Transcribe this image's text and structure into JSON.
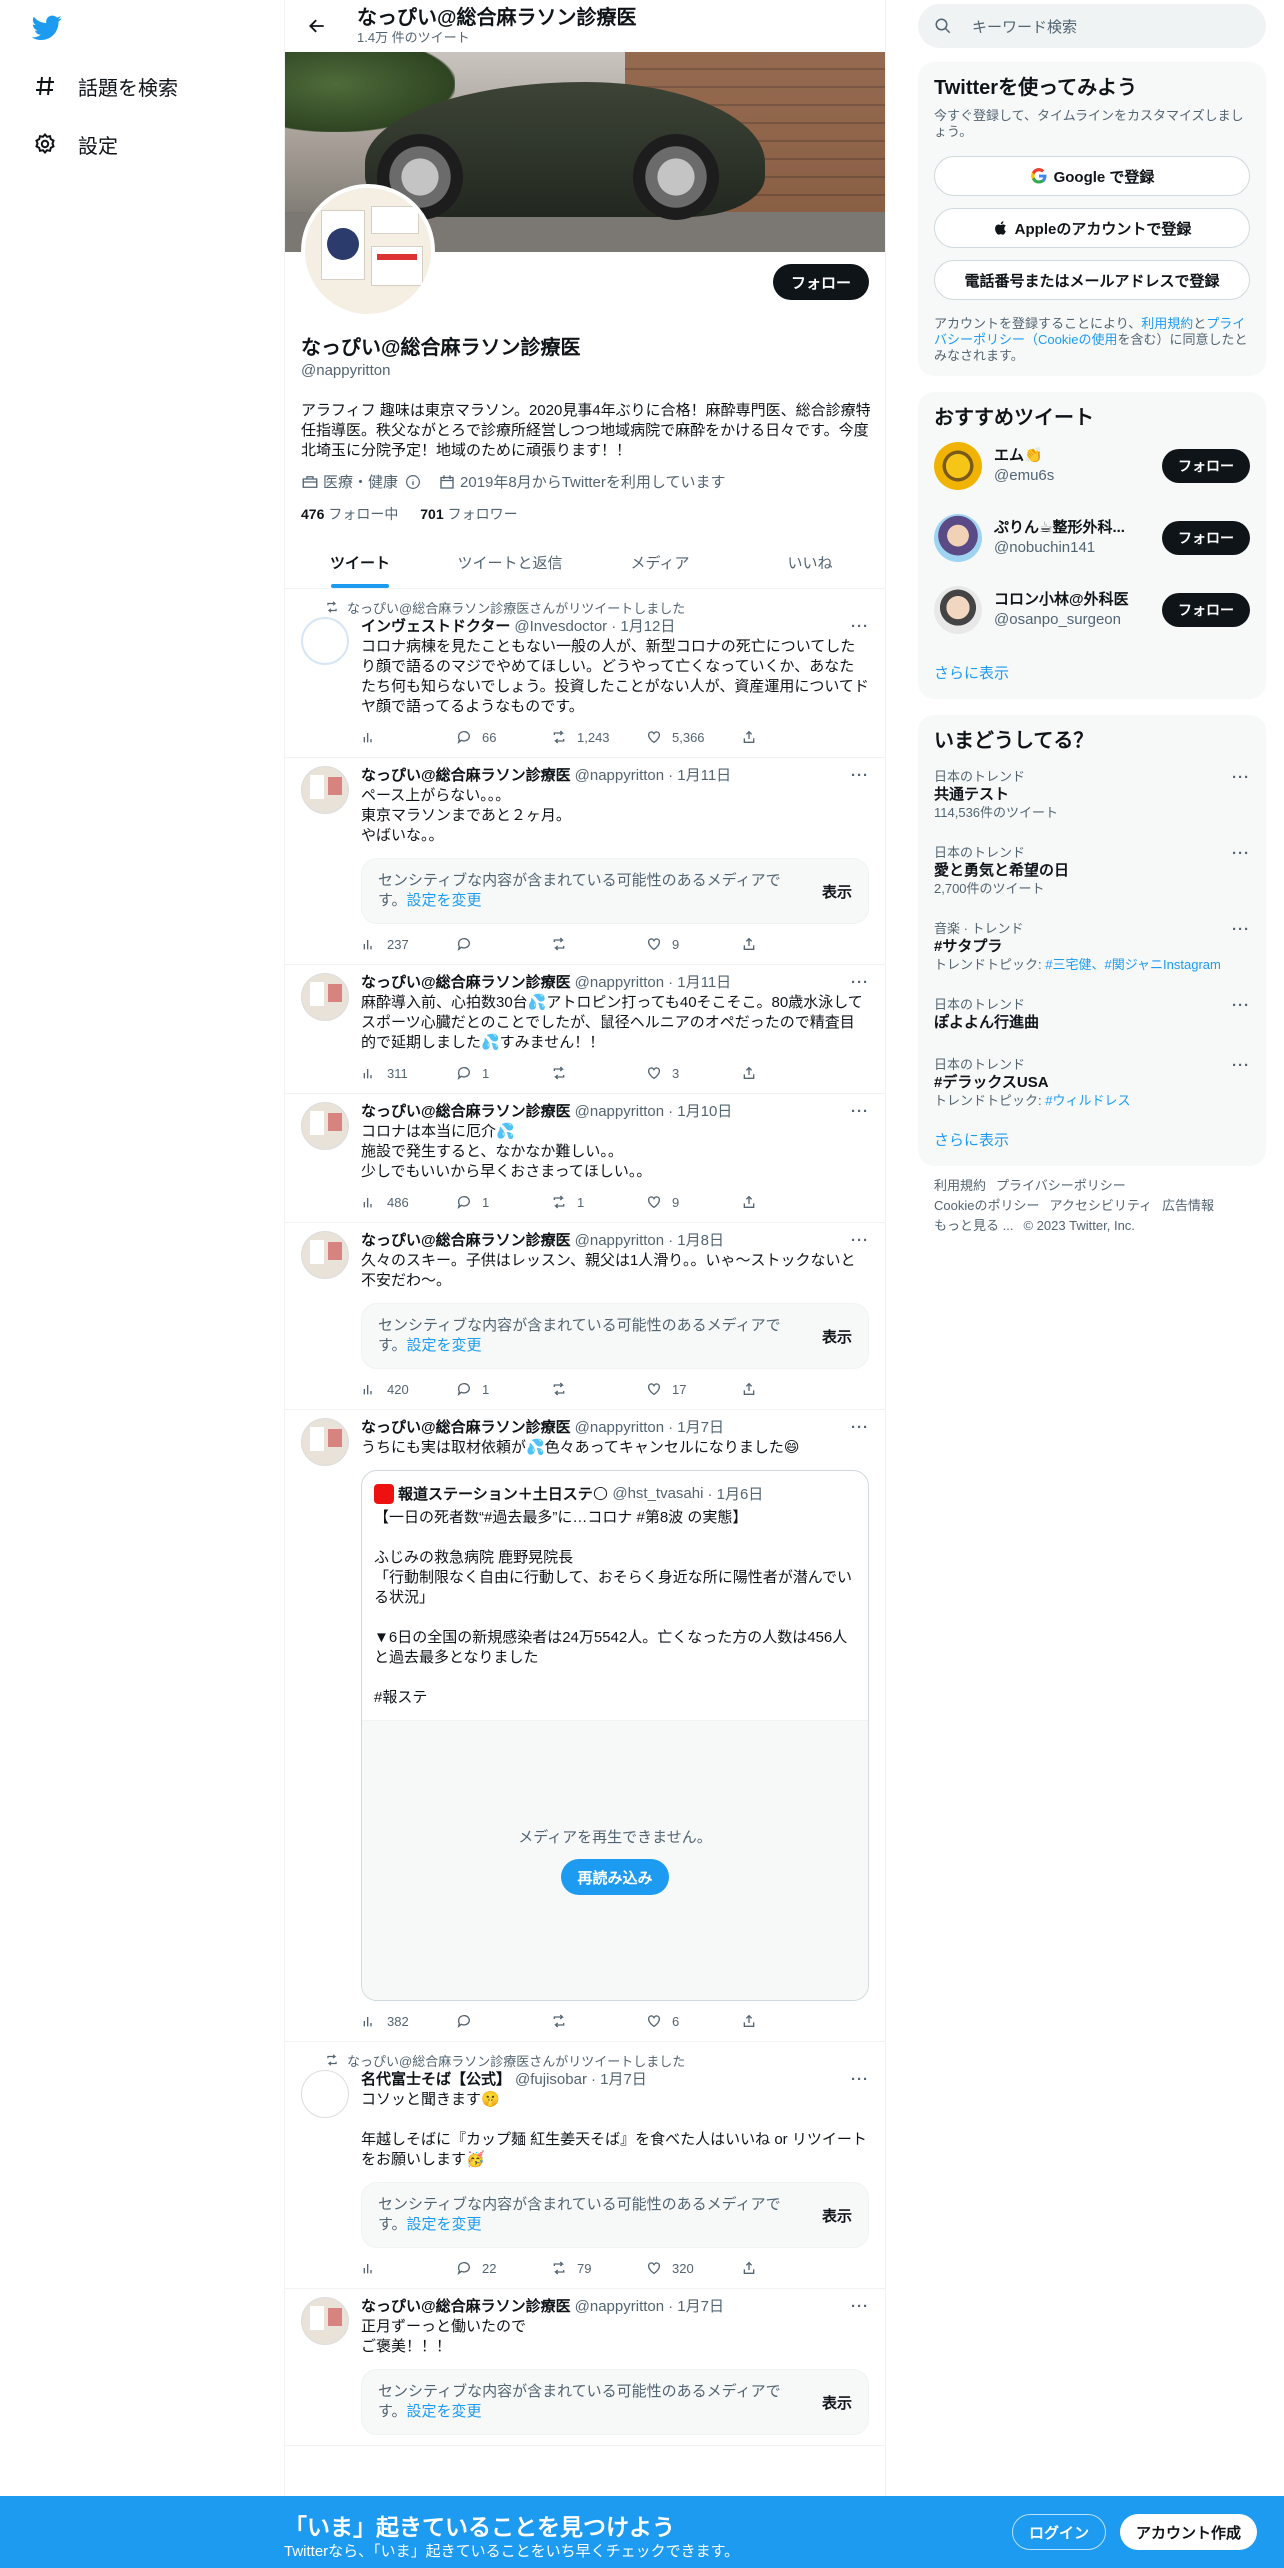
{
  "nav": {
    "explore": "話題を検索",
    "settings": "設定"
  },
  "header": {
    "title": "なっぴい@総合麻ラソン診療医",
    "tweet_count": "1.4万 件のツイート"
  },
  "profile": {
    "follow": "フォロー",
    "name": "なっぴい@総合麻ラソン診療医",
    "handle": "@nappyritton",
    "bio": "アラフィフ 趣味は東京マラソン。2020見事4年ぶりに合格！麻酔専門医、総合診療特任指導医。秩父ながとろで診療所経営しつつ地域病院で麻酔をかける日々です。今度北埼玉に分院予定！地域のために頑張ります！！",
    "category": "医療・健康",
    "joined": "2019年8月からTwitterを利用しています",
    "following_count": "476",
    "following_label": "フォロー中",
    "followers_count": "701",
    "followers_label": "フォロワー"
  },
  "tabs": [
    "ツイート",
    "ツイートと返信",
    "メディア",
    "いいね"
  ],
  "tweets": [
    {
      "retweeted_by": "なっぴい@総合麻ラソン診療医さんがリツイートしました",
      "name": "インヴェストドクター",
      "handle": "@Invesdoctor",
      "date": "· 1月12日",
      "text": "コロナ病棟を見たこともない一般の人が、新型コロナの死亡についてしたり顔で語るのマジでやめてほしい。どうやって亡くなっていくか、あなたたち何も知らないでしょう。投資したことがない人が、資産運用についてドヤ顔で語ってるようなものです。",
      "views": "",
      "replies": "66",
      "retweets": "1,243",
      "likes": "5,366"
    },
    {
      "name": "なっぴい@総合麻ラソン診療医",
      "handle": "@nappyritton",
      "date": "· 1月11日",
      "text": "ペース上がらない。。。\n東京マラソンまであと２ヶ月。\nやばいな。。",
      "sensitive": "センシティブな内容が含まれている可能性のあるメディアです。",
      "sensitive_link": "設定を変更",
      "show": "表示",
      "views": "237",
      "replies": "",
      "retweets": "",
      "likes": "9"
    },
    {
      "name": "なっぴい@総合麻ラソン診療医",
      "handle": "@nappyritton",
      "date": "· 1月11日",
      "text": "麻酔導入前、心拍数30台💦アトロピン打っても40そこそこ。80歳水泳してスポーツ心臓だとのことでしたが、鼠径ヘルニアのオペだったので精査目的で延期しました💦すみません！！",
      "views": "311",
      "replies": "1",
      "retweets": "",
      "likes": "3"
    },
    {
      "name": "なっぴい@総合麻ラソン診療医",
      "handle": "@nappyritton",
      "date": "· 1月10日",
      "text": "コロナは本当に厄介💦\n施設で発生すると、なかなか難しい。。\n少しでもいいから早くおさまってほしい。。",
      "views": "486",
      "replies": "1",
      "retweets": "1",
      "likes": "9"
    },
    {
      "name": "なっぴい@総合麻ラソン診療医",
      "handle": "@nappyritton",
      "date": "· 1月8日",
      "text": "久々のスキー。子供はレッスン、親父は1人滑り。。いゃ〜ストックないと不安だわ〜。",
      "sensitive": "センシティブな内容が含まれている可能性のあるメディアです。",
      "sensitive_link": "設定を変更",
      "show": "表示",
      "views": "420",
      "replies": "1",
      "retweets": "",
      "likes": "17"
    },
    {
      "name": "なっぴい@総合麻ラソン診療医",
      "handle": "@nappyritton",
      "date": "· 1月7日",
      "text": "うちにも実は取材依頼が💦色々あってキャンセルになりました😄",
      "quote": {
        "name": "報道ステーション＋土日ステ🌕",
        "handle": "@hst_tvasahi",
        "date": "· 1月6日",
        "text": "【一日の死者数“#過去最多”に…コロナ #第8波 の実態】\n\nふじみの救急病院 鹿野晃院長\n「行動制限なく自由に行動して、おそらく身近な所に陽性者が潜んでいる状況」\n\n▼6日の全国の新規感染者は24万5542人。亡くなった方の人数は456人と過去最多となりました\n\n#報ステ",
        "media_error": "メディアを再生できません。",
        "reload": "再読み込み"
      },
      "views": "382",
      "replies": "",
      "retweets": "",
      "likes": "6"
    },
    {
      "retweeted_by": "なっぴい@総合麻ラソン診療医さんがリツイートしました",
      "name": "名代富士そば【公式】",
      "handle": "@fujisobar",
      "date": "· 1月7日",
      "text": "コソッと聞きます🤫\n\n年越しそばに『カップ麺 紅生姜天そば』を食べた人はいいね or リツイートをお願いします🥳",
      "sensitive": "センシティブな内容が含まれている可能性のあるメディアです。",
      "sensitive_link": "設定を変更",
      "show": "表示",
      "views": "",
      "replies": "22",
      "retweets": "79",
      "likes": "320"
    },
    {
      "name": "なっぴい@総合麻ラソン診療医",
      "handle": "@nappyritton",
      "date": "· 1月7日",
      "text": "正月ずーっと働いたので\nご褒美！！！",
      "sensitive": "センシティブな内容が含まれている可能性のあるメディアです。",
      "sensitive_link": "設定を変更",
      "show": "表示"
    }
  ],
  "right": {
    "search_placeholder": "キーワード検索",
    "signup": {
      "title": "Twitterを使ってみよう",
      "subtitle": "今すぐ登録して、タイムラインをカスタマイズしましょう。",
      "google": "Google で登録",
      "apple": "Appleのアカウントで登録",
      "phone": "電話番号またはメールアドレスで登録",
      "legal_pre": "アカウントを登録することにより、",
      "legal_terms": "利用規約",
      "legal_and": "と",
      "legal_privacy": "プライバシーポリシー（Cookieの使用",
      "legal_post": "を含む）に同意したとみなされます。"
    },
    "who_to_follow": {
      "title": "おすすめツイート",
      "users": [
        {
          "name": "エム👏",
          "handle": "@emu6s",
          "button": "フォロー"
        },
        {
          "name": "ぷりん☕整形外科...",
          "handle": "@nobuchin141",
          "button": "フォロー"
        },
        {
          "name": "コロン小林@外科医",
          "handle": "@osanpo_surgeon",
          "button": "フォロー"
        }
      ],
      "show_more": "さらに表示"
    },
    "trends": {
      "title": "いまどうしてる？",
      "items": [
        {
          "context": "日本のトレンド",
          "name": "共通テスト",
          "extra": "114,536件のツイート"
        },
        {
          "context": "日本のトレンド",
          "name": "愛と勇気と希望の日",
          "extra": "2,700件のツイート"
        },
        {
          "context": "音楽 · トレンド",
          "name": "#サタプラ",
          "extra_pre": "トレンドトピック: ",
          "extra_links": "#三宅健、#関ジャニInstagram"
        },
        {
          "context": "日本のトレンド",
          "name": "ぽよよん行進曲",
          "extra": ""
        },
        {
          "context": "日本のトレンド",
          "name": "#デラックスUSA",
          "extra_pre": "トレンドトピック: ",
          "extra_links": "#ウィルドレス"
        }
      ],
      "show_more": "さらに表示"
    },
    "footer": {
      "terms": "利用規約",
      "privacy": "プライバシーポリシー",
      "cookie": "Cookieのポリシー",
      "accessibility": "アクセシビリティ",
      "ads": "広告情報",
      "more": "もっと見る ...",
      "copyright": "© 2023 Twitter, Inc."
    }
  },
  "bottom": {
    "title": "「いま」起きていることを見つけよう",
    "subtitle": "Twitterなら、「いま」起きていることをいち早くチェックできます。",
    "login": "ログイン",
    "signup": "アカウント作成"
  },
  "colors": {
    "accent": "#1d9bf0",
    "text": "#0f1419",
    "muted": "#536471"
  }
}
